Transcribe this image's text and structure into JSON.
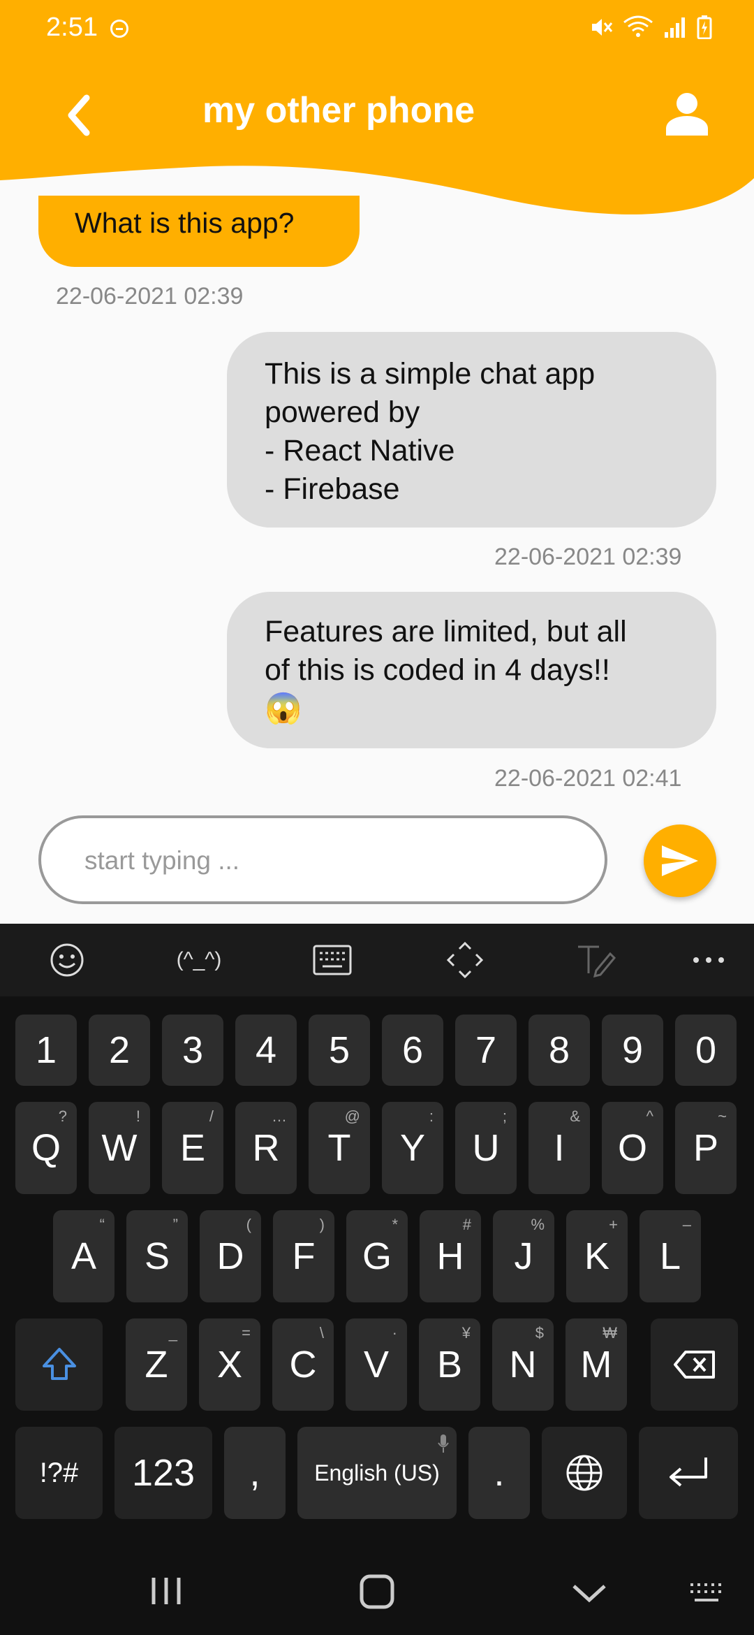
{
  "status_bar": {
    "time": "2:51"
  },
  "header": {
    "title": "my other phone"
  },
  "messages": {
    "incoming": {
      "text": "What is this app?",
      "timestamp": "22-06-2021 02:39"
    },
    "outgoing_1": {
      "text": "This is a simple chat app\npowered by\n- React Native\n- Firebase",
      "timestamp": "22-06-2021 02:39"
    },
    "outgoing_2": {
      "text": "Features are limited, but all\nof this is coded in 4 days!!\n😱",
      "timestamp": "22-06-2021 02:41"
    }
  },
  "composer": {
    "placeholder": "start typing ..."
  },
  "keyboard": {
    "toolbar": {
      "kaomoji": "(^_^)"
    },
    "numbers": [
      "1",
      "2",
      "3",
      "4",
      "5",
      "6",
      "7",
      "8",
      "9",
      "0"
    ],
    "row_q": {
      "keys": [
        "Q",
        "W",
        "E",
        "R",
        "T",
        "Y",
        "U",
        "I",
        "O",
        "P"
      ],
      "subs": [
        "?",
        "!",
        "/",
        "…",
        "@",
        ":",
        ";",
        "&",
        "^",
        "~"
      ]
    },
    "row_a": {
      "keys": [
        "A",
        "S",
        "D",
        "F",
        "G",
        "H",
        "J",
        "K",
        "L"
      ],
      "subs": [
        "“",
        "”",
        "(",
        ")",
        "*",
        "#",
        "%",
        "+",
        "–"
      ]
    },
    "row_z": {
      "keys": [
        "Z",
        "X",
        "C",
        "V",
        "B",
        "N",
        "M"
      ],
      "subs": [
        "_",
        "=",
        "\\",
        "·",
        "¥",
        "$",
        "₩"
      ]
    },
    "symbols_label": "!?#",
    "numbers_label": "123",
    "comma": ",",
    "space_label": "English (US)",
    "period": "."
  },
  "colors": {
    "accent": "#FFAF00",
    "bubble_out": "#DDDDDD",
    "keyboard_bg": "#111111",
    "key_bg": "#2D2D2D"
  }
}
